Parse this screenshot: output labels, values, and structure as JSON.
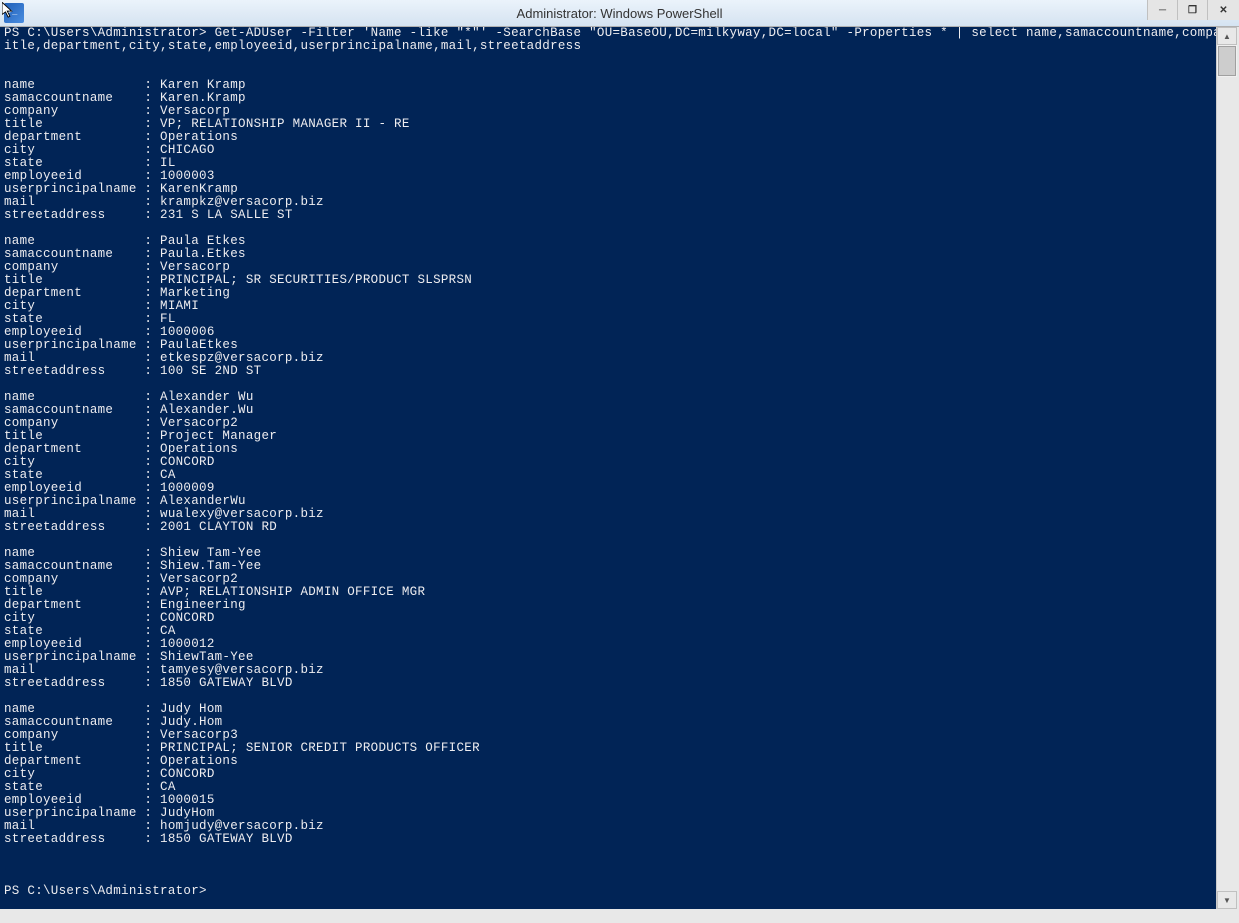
{
  "window": {
    "title": "Administrator: Windows PowerShell"
  },
  "terminal": {
    "prompt1": "PS C:\\Users\\Administrator> ",
    "command": "Get-ADUser -Filter 'Name -like \"*\"' -SearchBase \"OU=BaseOU,DC=milkyway,DC=local\" -Properties * | select name,samaccountname,company,t",
    "command_line2": "itle,department,city,state,employeeid,userprincipalname,mail,streetaddress",
    "prompt2": "PS C:\\Users\\Administrator>",
    "fields": [
      "name",
      "samaccountname",
      "company",
      "title",
      "department",
      "city",
      "state",
      "employeeid",
      "userprincipalname",
      "mail",
      "streetaddress"
    ],
    "records": [
      {
        "name": "Karen Kramp",
        "samaccountname": "Karen.Kramp",
        "company": "Versacorp",
        "title": "VP; RELATIONSHIP MANAGER II - RE",
        "department": "Operations",
        "city": "CHICAGO",
        "state": "IL",
        "employeeid": "1000003",
        "userprincipalname": "KarenKramp",
        "mail": "krampkz@versacorp.biz",
        "streetaddress": "231 S LA SALLE ST"
      },
      {
        "name": "Paula Etkes",
        "samaccountname": "Paula.Etkes",
        "company": "Versacorp",
        "title": "PRINCIPAL; SR SECURITIES/PRODUCT SLSPRSN",
        "department": "Marketing",
        "city": "MIAMI",
        "state": "FL",
        "employeeid": "1000006",
        "userprincipalname": "PaulaEtkes",
        "mail": "etkespz@versacorp.biz",
        "streetaddress": "100 SE 2ND ST"
      },
      {
        "name": "Alexander Wu",
        "samaccountname": "Alexander.Wu",
        "company": "Versacorp2",
        "title": "Project Manager",
        "department": "Operations",
        "city": "CONCORD",
        "state": "CA",
        "employeeid": "1000009",
        "userprincipalname": "AlexanderWu",
        "mail": "wualexy@versacorp.biz",
        "streetaddress": "2001 CLAYTON RD"
      },
      {
        "name": "Shiew Tam-Yee",
        "samaccountname": "Shiew.Tam-Yee",
        "company": "Versacorp2",
        "title": "AVP; RELATIONSHIP ADMIN OFFICE MGR",
        "department": "Engineering",
        "city": "CONCORD",
        "state": "CA",
        "employeeid": "1000012",
        "userprincipalname": "ShiewTam-Yee",
        "mail": "tamyesy@versacorp.biz",
        "streetaddress": "1850 GATEWAY BLVD"
      },
      {
        "name": "Judy Hom",
        "samaccountname": "Judy.Hom",
        "company": "Versacorp3",
        "title": "PRINCIPAL; SENIOR CREDIT PRODUCTS OFFICER",
        "department": "Operations",
        "city": "CONCORD",
        "state": "CA",
        "employeeid": "1000015",
        "userprincipalname": "JudyHom",
        "mail": "homjudy@versacorp.biz",
        "streetaddress": "1850 GATEWAY BLVD"
      }
    ]
  }
}
